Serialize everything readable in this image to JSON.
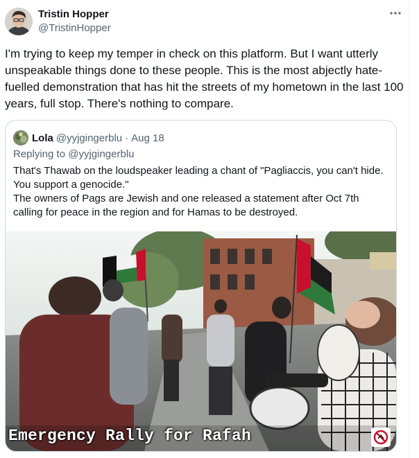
{
  "tweet": {
    "author_name": "Tristin Hopper",
    "author_handle": "@TristinHopper",
    "more_icon": "more-horizontal-icon",
    "text": "I'm trying to keep my temper in check on this platform. But I want utterly unspeakable things done to these people. This is the most abjectly hate-fuelled demonstration that has hit the streets of my hometown in the last 100 years, full stop. There's nothing to compare."
  },
  "quote": {
    "author_name": "Lola",
    "author_handle": "@yyjgingerblu",
    "separator": "·",
    "date": "Aug 18",
    "replying_prefix": "Replying to ",
    "replying_handle": "@yyjgingerblu",
    "text": "That's Thawab on the loudspeaker leading a chant of \"Pagliaccis, you can't hide. You support a genocide.\"\nThe owners of Pags are Jewish and one released a statement after Oct 7th calling for peace in the region and for Hamas to be destroyed.",
    "media": {
      "caption": "Emergency Rally for Rafah",
      "corner_icon": "no-symbol-icon"
    }
  },
  "colors": {
    "text_primary": "#0f1419",
    "text_secondary": "#536471",
    "border": "#cfd9de",
    "background": "#ffffff"
  }
}
